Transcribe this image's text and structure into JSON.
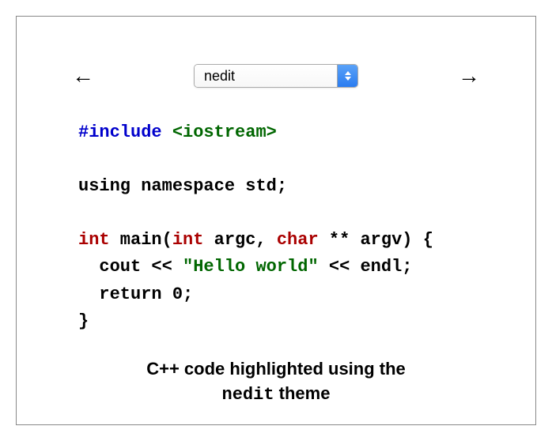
{
  "nav": {
    "prev_arrow": "←",
    "next_arrow": "→",
    "selected_theme": "nedit"
  },
  "code": {
    "line1_pp": "#include ",
    "line1_inc": "<iostream>",
    "line3_using": "using",
    "line3_namespace": " namespace",
    "line3_std": " std;",
    "line5_int": "int",
    "line5_main": " main(",
    "line5_int2": "int",
    "line5_argc": " argc, ",
    "line5_char": "char",
    "line5_rest": " ** argv) {",
    "line6_cout": "  cout << ",
    "line6_str": "\"Hello world\"",
    "line6_endl": " << endl;",
    "line7_return": "  return",
    "line7_zero": " 0",
    "line7_semi": ";",
    "line8": "}"
  },
  "caption": {
    "prefix": "C++ code highlighted using the ",
    "theme": "nedit",
    "suffix": " theme"
  }
}
